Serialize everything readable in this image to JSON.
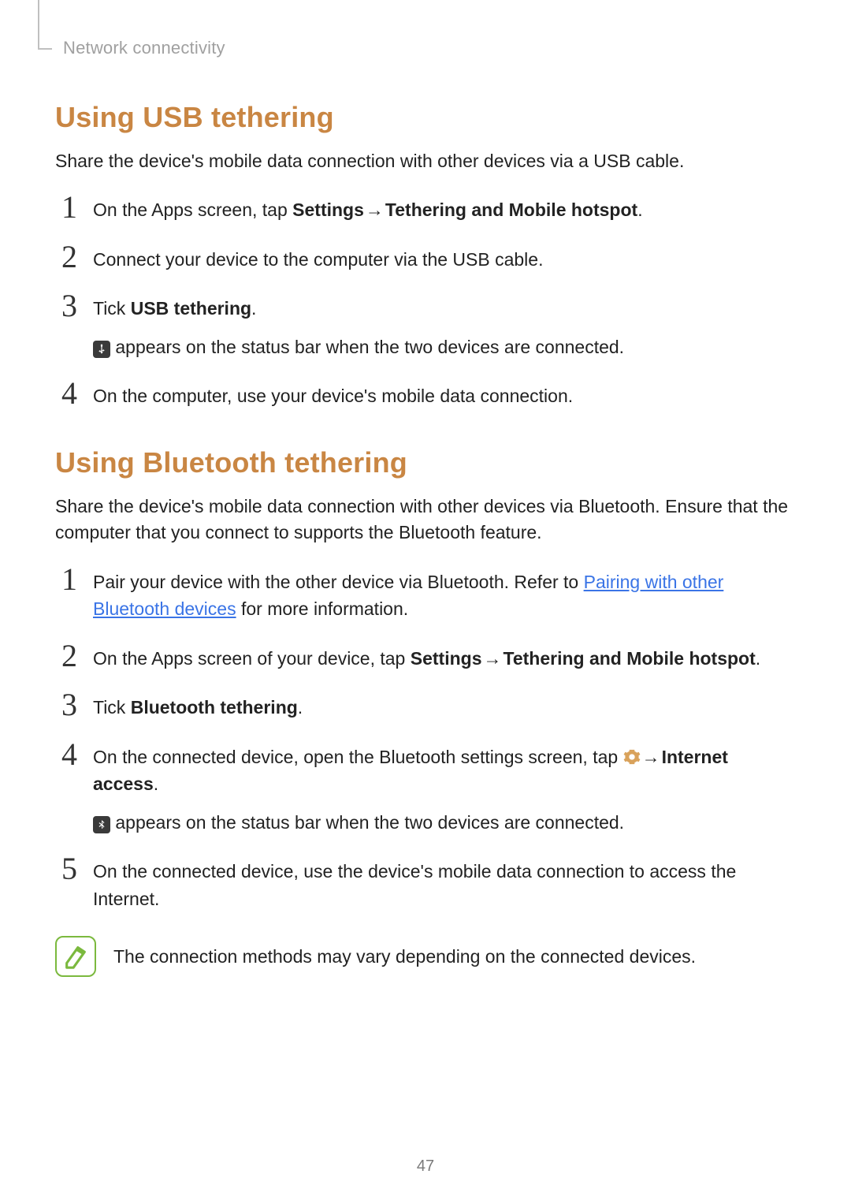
{
  "header": {
    "breadcrumb": "Network connectivity"
  },
  "usb": {
    "heading": "Using USB tethering",
    "intro": "Share the device's mobile data connection with other devices via a USB cable.",
    "steps": {
      "s1": {
        "pre": "On the Apps screen, tap ",
        "bold1": "Settings",
        "arrow": " → ",
        "bold2": "Tethering and Mobile hotspot",
        "post": "."
      },
      "s2": {
        "text": "Connect your device to the computer via the USB cable."
      },
      "s3": {
        "pre": "Tick ",
        "bold": "USB tethering",
        "post": ".",
        "sub_post": " appears on the status bar when the two devices are connected."
      },
      "s4": {
        "text": "On the computer, use your device's mobile data connection."
      }
    }
  },
  "bt": {
    "heading": "Using Bluetooth tethering",
    "intro": "Share the device's mobile data connection with other devices via Bluetooth. Ensure that the computer that you connect to supports the Bluetooth feature.",
    "steps": {
      "s1": {
        "pre": "Pair your device with the other device via Bluetooth. Refer to ",
        "link": "Pairing with other Bluetooth devices",
        "post": " for more information."
      },
      "s2": {
        "pre": "On the Apps screen of your device, tap ",
        "bold1": "Settings",
        "arrow": " → ",
        "bold2": "Tethering and Mobile hotspot",
        "post": "."
      },
      "s3": {
        "pre": "Tick ",
        "bold": "Bluetooth tethering",
        "post": "."
      },
      "s4": {
        "pre": "On the connected device, open the Bluetooth settings screen, tap ",
        "arrow": " → ",
        "bold": "Internet access",
        "post": ".",
        "sub_post": " appears on the status bar when the two devices are connected."
      },
      "s5": {
        "text": "On the connected device, use the device's mobile data connection to access the Internet."
      }
    },
    "note": "The connection methods may vary depending on the connected devices."
  },
  "page_number": "47",
  "numbers": {
    "n1": "1",
    "n2": "2",
    "n3": "3",
    "n4": "4",
    "n5": "5"
  }
}
